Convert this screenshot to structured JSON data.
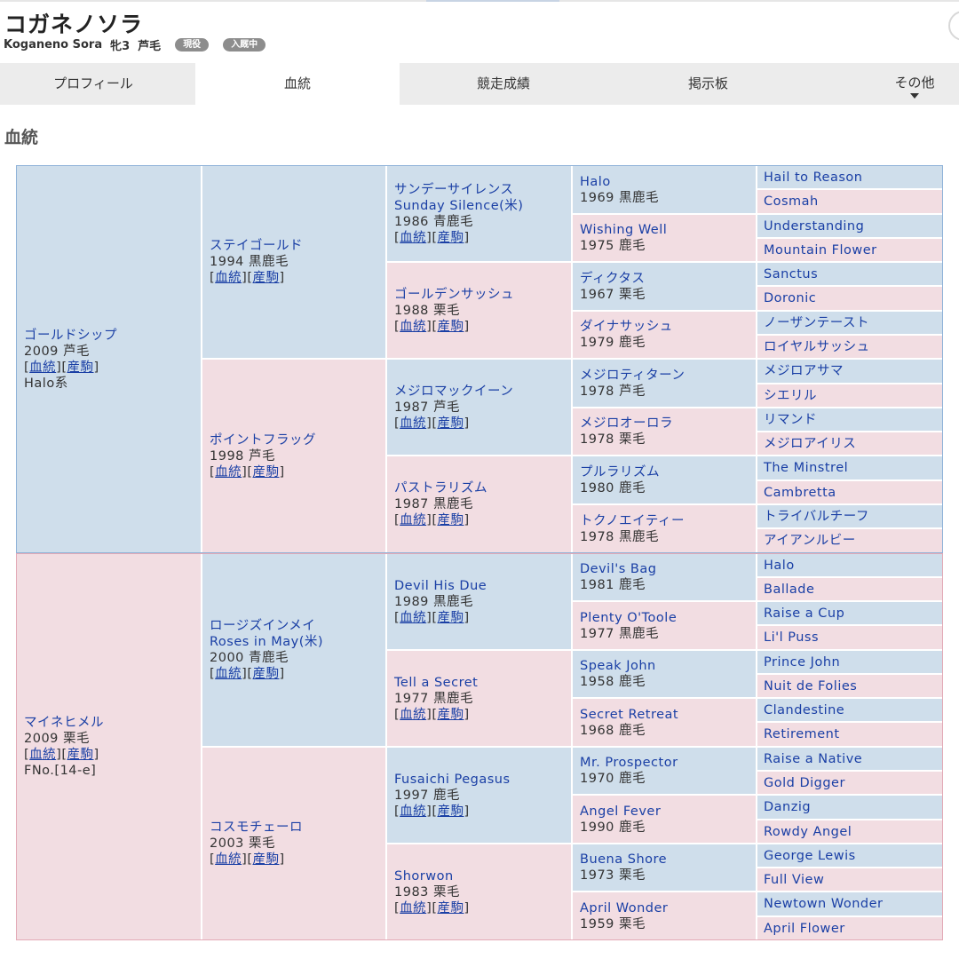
{
  "header": {
    "name": "コガネノソラ",
    "romaji": "Koganeno Sora",
    "sex_age": "牝3",
    "coat": "芦毛",
    "badges": [
      "現役",
      "入厩中"
    ]
  },
  "tabs": [
    {
      "label": "プロフィール",
      "active": false
    },
    {
      "label": "血統",
      "active": true
    },
    {
      "label": "競走成績",
      "active": false
    },
    {
      "label": "掲示板",
      "active": false
    },
    {
      "label": "その他",
      "active": false
    }
  ],
  "section_title": "血統",
  "link_labels": {
    "pedigree": "血統",
    "progeny": "産駒"
  },
  "pedigree": {
    "gen1": [
      {
        "name": "ゴールドシップ",
        "info": "2009 芦毛",
        "extra": "Halo系",
        "sex": "m"
      },
      {
        "name": "マイネヒメル",
        "info": "2009 栗毛",
        "extra": "FNo.[14-e]",
        "sex": "f"
      }
    ],
    "gen2": [
      {
        "name": "ステイゴールド",
        "info": "1994 黒鹿毛",
        "sex": "m"
      },
      {
        "name": "ポイントフラッグ",
        "info": "1998 芦毛",
        "sex": "f"
      },
      {
        "name": "ロージズインメイ",
        "name2": "Roses in May(米)",
        "info": "2000 青鹿毛",
        "sex": "m"
      },
      {
        "name": "コスモチェーロ",
        "info": "2003 栗毛",
        "sex": "f"
      }
    ],
    "gen3": [
      {
        "name": "サンデーサイレンス",
        "name2": "Sunday Silence(米)",
        "info": "1986 青鹿毛",
        "sex": "m"
      },
      {
        "name": "ゴールデンサッシュ",
        "info": "1988 栗毛",
        "sex": "f"
      },
      {
        "name": "メジロマックイーン",
        "info": "1987 芦毛",
        "sex": "m"
      },
      {
        "name": "パストラリズム",
        "info": "1987 黒鹿毛",
        "sex": "f"
      },
      {
        "name": "Devil His Due",
        "info": "1989 黒鹿毛",
        "sex": "m"
      },
      {
        "name": "Tell a Secret",
        "info": "1977 黒鹿毛",
        "sex": "f"
      },
      {
        "name": "Fusaichi Pegasus",
        "info": "1997 鹿毛",
        "sex": "m"
      },
      {
        "name": "Shorwon",
        "info": "1983 栗毛",
        "sex": "f"
      }
    ],
    "gen4": [
      {
        "name": "Halo",
        "info": "1969 黒鹿毛",
        "sex": "m"
      },
      {
        "name": "Wishing Well",
        "info": "1975 鹿毛",
        "sex": "f"
      },
      {
        "name": "ディクタス",
        "info": "1967 栗毛",
        "sex": "m"
      },
      {
        "name": "ダイナサッシュ",
        "info": "1979 鹿毛",
        "sex": "f"
      },
      {
        "name": "メジロティターン",
        "info": "1978 芦毛",
        "sex": "m"
      },
      {
        "name": "メジロオーロラ",
        "info": "1978 栗毛",
        "sex": "f"
      },
      {
        "name": "プルラリズム",
        "info": "1980 鹿毛",
        "sex": "m"
      },
      {
        "name": "トクノエイティー",
        "info": "1978 黒鹿毛",
        "sex": "f"
      },
      {
        "name": "Devil's Bag",
        "info": "1981 鹿毛",
        "sex": "m"
      },
      {
        "name": "Plenty O'Toole",
        "info": "1977 黒鹿毛",
        "sex": "f"
      },
      {
        "name": "Speak John",
        "info": "1958 鹿毛",
        "sex": "m"
      },
      {
        "name": "Secret Retreat",
        "info": "1968 鹿毛",
        "sex": "f"
      },
      {
        "name": "Mr. Prospector",
        "info": "1970 鹿毛",
        "sex": "m"
      },
      {
        "name": "Angel Fever",
        "info": "1990 鹿毛",
        "sex": "f"
      },
      {
        "name": "Buena Shore",
        "info": "1973 栗毛",
        "sex": "m"
      },
      {
        "name": "April Wonder",
        "info": "1959 栗毛",
        "sex": "f"
      }
    ],
    "gen5": [
      "Hail to Reason",
      "Cosmah",
      "Understanding",
      "Mountain Flower",
      "Sanctus",
      "Doronic",
      "ノーザンテースト",
      "ロイヤルサッシュ",
      "メジロアサマ",
      "シエリル",
      "リマンド",
      "メジロアイリス",
      "The Minstrel",
      "Cambretta",
      "トライバルチーフ",
      "アイアンルビー",
      "Halo",
      "Ballade",
      "Raise a Cup",
      "Li'l Puss",
      "Prince John",
      "Nuit de Folies",
      "Clandestine",
      "Retirement",
      "Raise a Native",
      "Gold Digger",
      "Danzig",
      "Rowdy Angel",
      "George Lewis",
      "Full View",
      "Newtown Wonder",
      "April Flower"
    ]
  }
}
